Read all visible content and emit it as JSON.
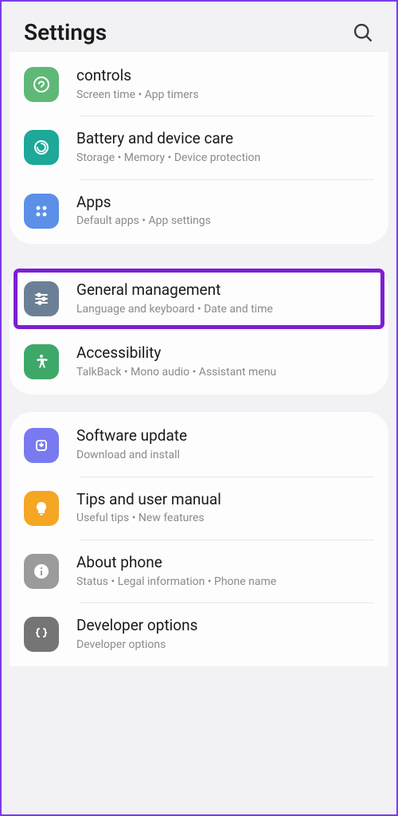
{
  "header": {
    "title": "Settings"
  },
  "groups": [
    {
      "items": [
        {
          "title": "controls",
          "subtitle": "Screen time  •  App timers"
        },
        {
          "title": "Battery and device care",
          "subtitle": "Storage  •  Memory  •  Device protection"
        },
        {
          "title": "Apps",
          "subtitle": "Default apps  •  App settings"
        }
      ]
    },
    {
      "items": [
        {
          "title": "General management",
          "subtitle": "Language and keyboard  •  Date and time"
        },
        {
          "title": "Accessibility",
          "subtitle": "TalkBack  •  Mono audio  •  Assistant menu"
        }
      ]
    },
    {
      "items": [
        {
          "title": "Software update",
          "subtitle": "Download and install"
        },
        {
          "title": "Tips and user manual",
          "subtitle": "Useful tips  •  New features"
        },
        {
          "title": "About phone",
          "subtitle": "Status  •  Legal information  •  Phone name"
        },
        {
          "title": "Developer options",
          "subtitle": "Developer options"
        }
      ]
    }
  ]
}
